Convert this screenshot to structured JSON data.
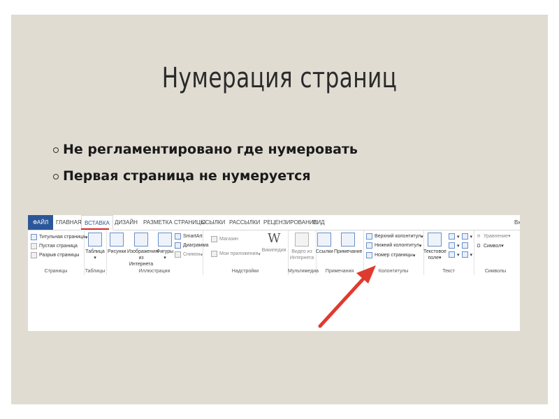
{
  "slide": {
    "title": "Нумерация страниц",
    "bullets": [
      "Не регламентировано где нумеровать",
      "Первая страница не нумеруется"
    ]
  },
  "ribbon": {
    "tabs": [
      "ФАЙЛ",
      "ГЛАВНАЯ",
      "ВСТАВКА",
      "ДИЗАЙН",
      "РАЗМЕТКА СТРАНИЦЫ",
      "ССЫЛКИ",
      "РАССЫЛКИ",
      "РЕЦЕНЗИРОВАНИЕ",
      "ВИД",
      "Вх"
    ],
    "active_tab": "ВСТАВКА",
    "groups": {
      "pages": {
        "label": "Страницы",
        "items": [
          "Титульная страница",
          "Пустая страница",
          "Разрыв страницы"
        ]
      },
      "tables": {
        "label": "Таблицы",
        "button": "Таблица"
      },
      "illustrations": {
        "label": "Иллюстрации",
        "buttons": [
          "Рисунки",
          "Изображения из Интернета",
          "Фигуры"
        ],
        "small": [
          "SmartArt",
          "Диаграмма",
          "Снимок"
        ]
      },
      "addins": {
        "label": "Надстройки",
        "small": [
          "Магазин",
          "Мои приложения"
        ],
        "button": "Википедия"
      },
      "media": {
        "label": "Мультимедиа",
        "button": "Видео из Интернета"
      },
      "comments": {
        "label": "Примечания",
        "buttons": [
          "Ссылки",
          "Примечание"
        ]
      },
      "headers": {
        "label": "Колонтитулы",
        "items": [
          "Верхний колонтитул",
          "Нижний колонтитул",
          "Номер страницы"
        ]
      },
      "text": {
        "label": "Текст",
        "button": "Текстовое поле"
      },
      "symbols": {
        "label": "Символы",
        "items": [
          "Уравнение",
          "Символ"
        ]
      }
    }
  },
  "colors": {
    "slide_bg": "#e0dcd2",
    "file_tab": "#2b579a",
    "active_underline": "#dd2222",
    "arrow": "#e03a2f"
  }
}
